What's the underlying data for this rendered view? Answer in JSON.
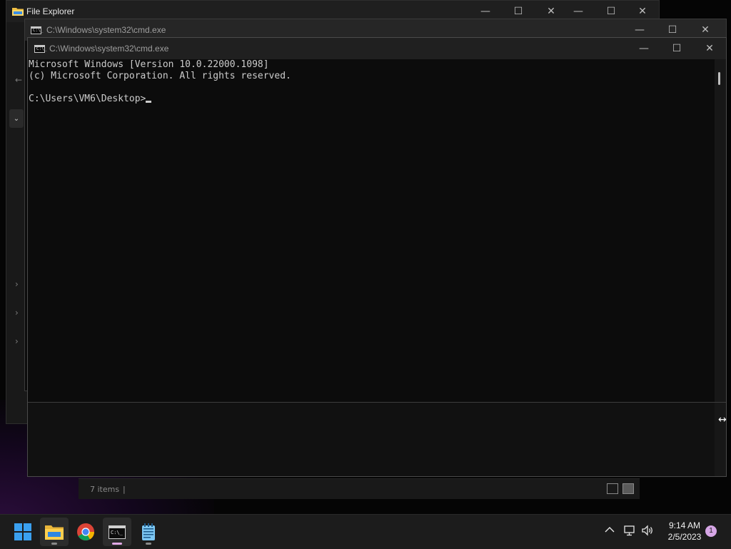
{
  "file_explorer": {
    "title": "File Explorer",
    "status_items": "7 items",
    "status_separator": "|",
    "controls": {
      "minimize": "—",
      "maximize": "☐",
      "close": "✕"
    }
  },
  "cmd_back": {
    "title": "C:\\Windows\\system32\\cmd.exe",
    "icon_text": "C:\\_"
  },
  "cmd_front": {
    "title": "C:\\Windows\\system32\\cmd.exe",
    "icon_text": "C:\\_",
    "console_lines": [
      "Microsoft Windows [Version 10.0.22000.1098]",
      "(c) Microsoft Corporation. All rights reserved.",
      "",
      "C:\\Users\\VM6\\Desktop>"
    ]
  },
  "window_controls": {
    "minimize": "—",
    "maximize": "☐",
    "close": "✕"
  },
  "taskbar": {
    "apps": [
      {
        "name": "start",
        "icon": "windows-logo-icon"
      },
      {
        "name": "file-explorer",
        "icon": "folder-icon",
        "running": true
      },
      {
        "name": "chrome",
        "icon": "chrome-icon"
      },
      {
        "name": "command-prompt",
        "icon": "cmd-icon",
        "running": true,
        "focused": true
      },
      {
        "name": "notepad",
        "icon": "notepad-icon",
        "running": true
      }
    ],
    "tray": {
      "chevron": "^",
      "time": "9:14 AM",
      "date": "2/5/2023",
      "notification_count": "1"
    }
  },
  "colors": {
    "console_bg": "#0c0c0c",
    "console_text": "#cccccc",
    "taskbar_bg": "#1c1c1c",
    "accent": "#e1a9e6"
  }
}
